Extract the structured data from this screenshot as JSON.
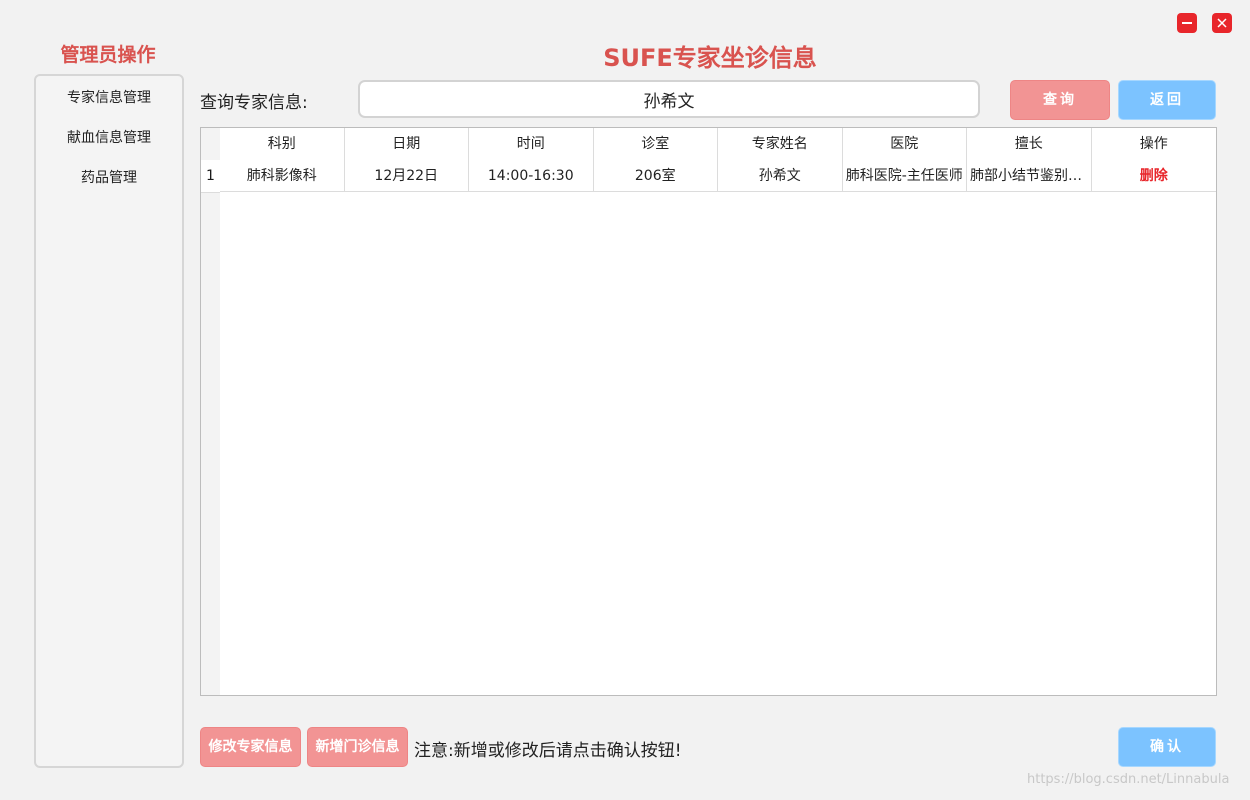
{
  "window": {
    "minimize_icon": "minimize-icon",
    "close_icon": "close-icon",
    "control_color": "#e8262b"
  },
  "sidebar": {
    "title": "管理员操作",
    "items": [
      {
        "label": "专家信息管理"
      },
      {
        "label": "献血信息管理"
      },
      {
        "label": "药品管理"
      }
    ]
  },
  "header": {
    "title": "SUFE专家坐诊信息",
    "accent_color": "#d9534f"
  },
  "search": {
    "label": "查询专家信息:",
    "value": "孙希文",
    "query_label": "查询",
    "back_label": "返回"
  },
  "table": {
    "columns": [
      "科别",
      "日期",
      "时间",
      "诊室",
      "专家姓名",
      "医院",
      "擅长",
      "操作"
    ],
    "rows": [
      {
        "num": "1",
        "cells": [
          "肺科影像科",
          "12月22日",
          "14:00-16:30",
          "206室",
          "孙希文",
          "肺科医院-主任医师",
          "肺部小结节鉴别诊断",
          "删除"
        ]
      }
    ]
  },
  "bottom": {
    "modify_label": "修改专家信息",
    "add_label": "新增门诊信息",
    "notice": "注意:新增或修改后请点击确认按钮!",
    "confirm_label": "确认",
    "watermark": "https://blog.csdn.net/Linnabula"
  },
  "colors": {
    "red_button": "#f29494",
    "blue_button": "#7cc3ff",
    "delete_text": "#e8262b"
  }
}
